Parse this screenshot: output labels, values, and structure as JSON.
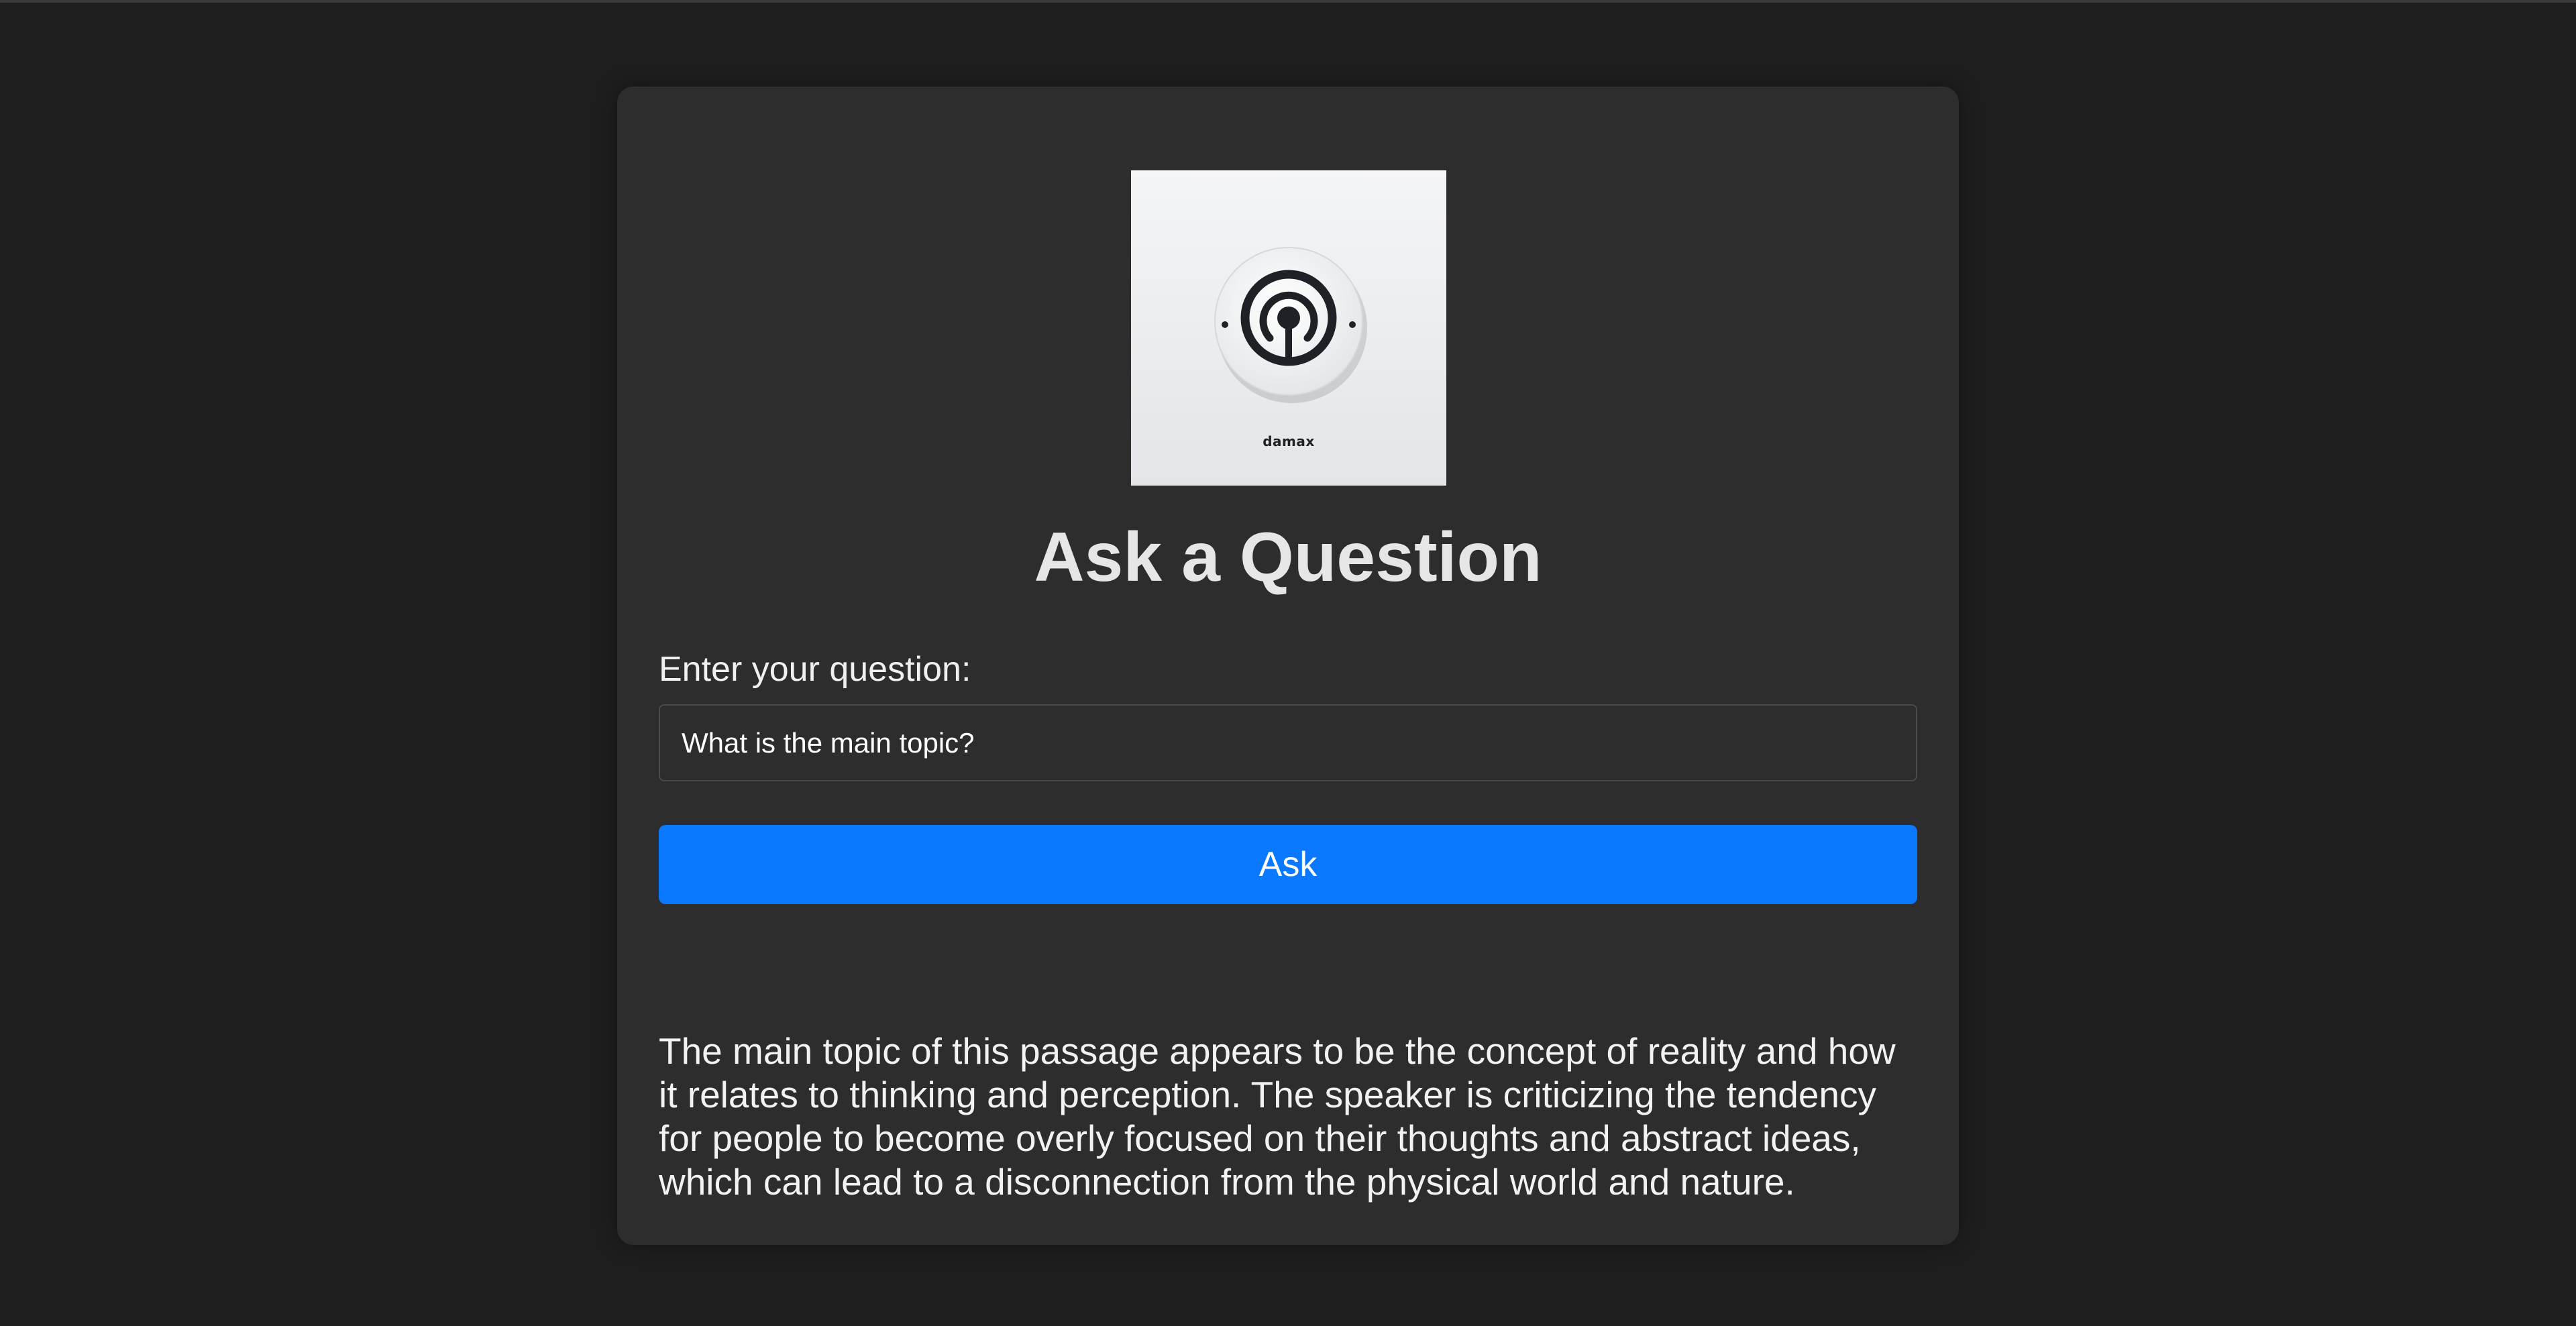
{
  "logo": {
    "icon": "maze-target-icon",
    "wordmark": "damax"
  },
  "page": {
    "title": "Ask a Question"
  },
  "form": {
    "question_label": "Enter your question:",
    "question_value": "What is the main topic?",
    "ask_label": "Ask"
  },
  "answer": {
    "text": "The main topic of this passage appears to be the concept of reality and how it relates to thinking and perception. The speaker is criticizing the tendency for people to become overly focused on their thoughts and abstract ideas, which can lead to a disconnection from the physical world and nature."
  },
  "colors": {
    "background": "#1e1e1e",
    "card": "#2d2d2d",
    "accent": "#0a78ff",
    "text": "#f2f2f2"
  }
}
